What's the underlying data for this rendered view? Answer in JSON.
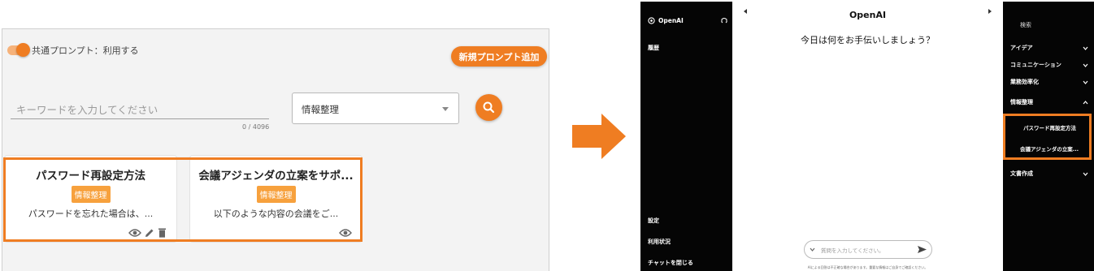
{
  "colors": {
    "accent": "#ef7d22",
    "tag": "#f7a13d",
    "dark": "#050505"
  },
  "left_panel": {
    "toggle_label": "共通プロンプト：利用する",
    "new_prompt_button": "新規プロンプト追加",
    "search_placeholder": "キーワードを入力してください",
    "counter": "0 / 4096",
    "category_select": "情報整理",
    "cards": [
      {
        "title": "パスワード再設定方法",
        "tag": "情報整理",
        "desc": "パスワードを忘れた場合は、..."
      },
      {
        "title": "会議アジェンダの立案をサポ...",
        "tag": "情報整理",
        "desc": "以下のような内容の会議をご..."
      }
    ]
  },
  "right_panel": {
    "sidebar_left": {
      "brand": "OpenAI",
      "history": "履歴",
      "settings": "設定",
      "usage": "利用状況",
      "close_chat": "チャットを閉じる"
    },
    "chat": {
      "title": "OpenAI",
      "greeting": "今日は何をお手伝いしましょう？",
      "input_placeholder": "質問を入力してください。",
      "footer": "AIによる回答は不正確な場合があります。重要な情報はご自身でご確認ください。"
    },
    "sidebar_right": {
      "search": "検索",
      "categories": [
        "アイデア",
        "コミュニケーション",
        "業務効率化",
        "情報整理",
        "文書作成"
      ],
      "sub_items": [
        "パスワード再設定方法",
        "会議アジェンダの立案..."
      ]
    }
  }
}
